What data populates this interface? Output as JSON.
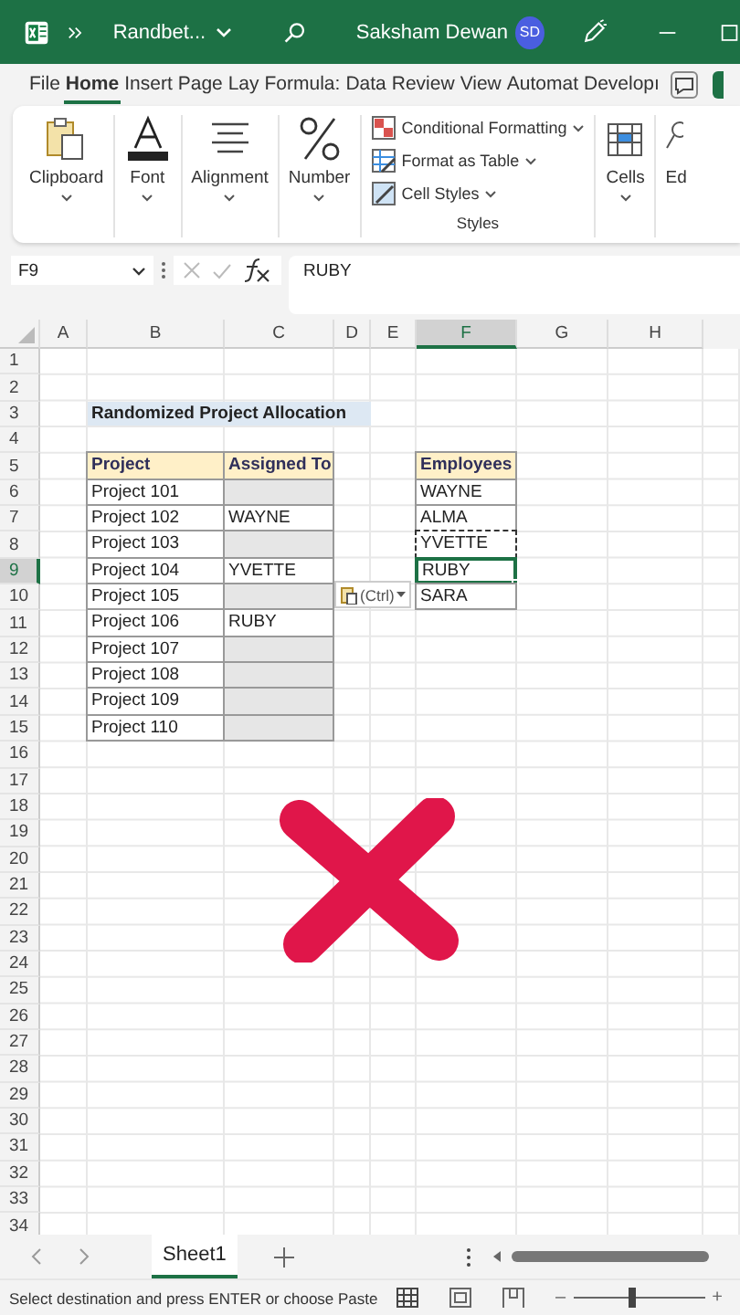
{
  "title_bar": {
    "file_name": "Randbet...",
    "user": "Saksham Dewan",
    "avatar": "SD"
  },
  "menu_tabs": [
    {
      "label": "File",
      "selected": false
    },
    {
      "label": "Home",
      "selected": true
    },
    {
      "label": "Insert",
      "selected": false
    },
    {
      "label": "Page Lay",
      "selected": false
    },
    {
      "label": "Formula:",
      "selected": false
    },
    {
      "label": "Data",
      "selected": false
    },
    {
      "label": "Review",
      "selected": false
    },
    {
      "label": "View",
      "selected": false
    },
    {
      "label": "Automat",
      "selected": false
    },
    {
      "label": "Developı",
      "selected": false
    }
  ],
  "ribbon": {
    "groups": [
      {
        "kind": "button",
        "label": "Clipboard"
      },
      {
        "kind": "button",
        "label": "Font"
      },
      {
        "kind": "button",
        "label": "Alignment"
      },
      {
        "kind": "button",
        "label": "Number"
      },
      {
        "kind": "list",
        "label": "Styles",
        "items": [
          "Conditional Formatting",
          "Format as Table",
          "Cell Styles"
        ]
      },
      {
        "kind": "button",
        "label": "Cells"
      },
      {
        "kind": "cut",
        "label": "Ed"
      }
    ]
  },
  "formula_bar": {
    "name_box": "F9",
    "value": "RUBY"
  },
  "columns": [
    {
      "label": "A",
      "selected": false
    },
    {
      "label": "B",
      "selected": false
    },
    {
      "label": "C",
      "selected": false
    },
    {
      "label": "D",
      "selected": false
    },
    {
      "label": "E",
      "selected": false
    },
    {
      "label": "F",
      "selected": true
    },
    {
      "label": "G",
      "selected": false
    },
    {
      "label": "H",
      "selected": false
    }
  ],
  "rows": [
    {
      "number": "1",
      "selected": false
    },
    {
      "number": "2",
      "selected": false
    },
    {
      "number": "3",
      "selected": false,
      "cells": {
        "B": {
          "kind": "title",
          "text": "Randomized Project Allocation"
        },
        "C": {
          "kind": "title"
        },
        "D": {
          "kind": "title"
        }
      }
    },
    {
      "number": "4",
      "selected": false
    },
    {
      "number": "5",
      "selected": false,
      "cells": {
        "B": {
          "kind": "header",
          "text": "Project"
        },
        "C": {
          "kind": "header",
          "text": "Assigned To"
        },
        "F": {
          "kind": "header",
          "text": "Employees"
        }
      }
    },
    {
      "number": "6",
      "selected": false,
      "cells": {
        "B": {
          "kind": "plain",
          "text": "Project 101"
        },
        "C": {
          "kind": "shaded"
        },
        "F": {
          "kind": "plain",
          "text": "WAYNE"
        }
      }
    },
    {
      "number": "7",
      "selected": false,
      "cells": {
        "B": {
          "kind": "plain",
          "text": "Project 102"
        },
        "C": {
          "kind": "plain",
          "text": "WAYNE"
        },
        "F": {
          "kind": "plain",
          "text": "ALMA"
        }
      }
    },
    {
      "number": "8",
      "selected": false,
      "cells": {
        "B": {
          "kind": "plain",
          "text": "Project 103"
        },
        "C": {
          "kind": "shaded"
        },
        "F": {
          "kind": "plain",
          "text": "YVETTE",
          "copied": true
        }
      }
    },
    {
      "number": "9",
      "selected": true,
      "cells": {
        "B": {
          "kind": "plain",
          "text": "Project 104"
        },
        "C": {
          "kind": "plain",
          "text": "YVETTE"
        },
        "F": {
          "kind": "plain",
          "text": "RUBY",
          "selected": true
        }
      }
    },
    {
      "number": "10",
      "selected": false,
      "cells": {
        "B": {
          "kind": "plain",
          "text": "Project 105"
        },
        "C": {
          "kind": "shaded"
        },
        "F": {
          "kind": "plain",
          "text": "SARA"
        }
      }
    },
    {
      "number": "11",
      "selected": false,
      "cells": {
        "B": {
          "kind": "plain",
          "text": "Project 106"
        },
        "C": {
          "kind": "plain",
          "text": "RUBY"
        }
      }
    },
    {
      "number": "12",
      "selected": false,
      "cells": {
        "B": {
          "kind": "plain",
          "text": "Project 107"
        },
        "C": {
          "kind": "shaded"
        }
      }
    },
    {
      "number": "13",
      "selected": false,
      "cells": {
        "B": {
          "kind": "plain",
          "text": "Project 108"
        },
        "C": {
          "kind": "shaded"
        }
      }
    },
    {
      "number": "14",
      "selected": false,
      "cells": {
        "B": {
          "kind": "plain",
          "text": "Project 109"
        },
        "C": {
          "kind": "shaded"
        }
      }
    },
    {
      "number": "15",
      "selected": false,
      "cells": {
        "B": {
          "kind": "plain",
          "text": "Project 110"
        },
        "C": {
          "kind": "shaded"
        }
      }
    },
    {
      "number": "16",
      "selected": false
    },
    {
      "number": "17",
      "selected": false
    },
    {
      "number": "18",
      "selected": false
    },
    {
      "number": "19",
      "selected": false
    },
    {
      "number": "20",
      "selected": false
    },
    {
      "number": "21",
      "selected": false
    },
    {
      "number": "22",
      "selected": false
    },
    {
      "number": "23",
      "selected": false
    },
    {
      "number": "24",
      "selected": false
    },
    {
      "number": "25",
      "selected": false
    },
    {
      "number": "26",
      "selected": false
    },
    {
      "number": "27",
      "selected": false
    },
    {
      "number": "28",
      "selected": false
    },
    {
      "number": "29",
      "selected": false
    },
    {
      "number": "30",
      "selected": false
    },
    {
      "number": "31",
      "selected": false
    },
    {
      "number": "32",
      "selected": false
    },
    {
      "number": "33",
      "selected": false
    },
    {
      "number": "34",
      "selected": false
    }
  ],
  "paste_options": {
    "label": "(Ctrl)"
  },
  "sheet_tabs": [
    {
      "label": "Sheet1",
      "selected": true
    }
  ],
  "status_bar": {
    "message": "Select destination and press ENTER or choose Paste",
    "zoom": {
      "out_label": "–",
      "level": 0.45,
      "in_label": "+"
    }
  }
}
